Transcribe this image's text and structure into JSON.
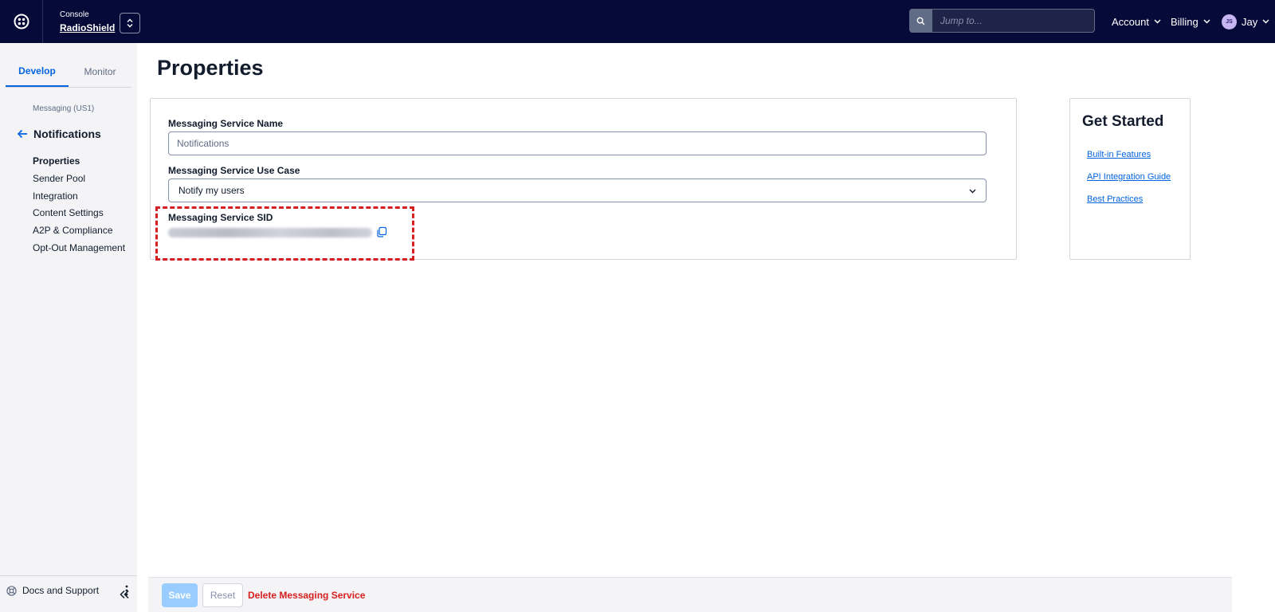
{
  "topbar": {
    "console_label": "Console",
    "account_name": "RadioShield",
    "search_placeholder": "Jump to...",
    "account_menu": "Account",
    "billing_menu": "Billing",
    "user_initials": "JS",
    "user_name": "Jay"
  },
  "sidebar": {
    "tabs": [
      {
        "label": "Develop",
        "active": true
      },
      {
        "label": "Monitor",
        "active": false
      }
    ],
    "breadcrumb": "Messaging (US1)",
    "section_title": "Notifications",
    "items": [
      {
        "label": "Properties",
        "active": true
      },
      {
        "label": "Sender Pool"
      },
      {
        "label": "Integration"
      },
      {
        "label": "Content Settings"
      },
      {
        "label": "A2P & Compliance"
      },
      {
        "label": "Opt-Out Management"
      }
    ],
    "docs_label": "Docs and Support"
  },
  "main": {
    "page_title": "Properties",
    "fields": {
      "name_label": "Messaging Service Name",
      "name_placeholder": "Notifications",
      "use_case_label": "Messaging Service Use Case",
      "use_case_value": "Notify my users",
      "sid_label": "Messaging Service SID"
    }
  },
  "get_started": {
    "title": "Get Started",
    "links": [
      "Built-in Features",
      "API Integration Guide",
      "Best Practices"
    ]
  },
  "footer": {
    "save_label": "Save",
    "reset_label": "Reset",
    "delete_label": "Delete Messaging Service"
  },
  "colors": {
    "topbar_bg": "#060a38",
    "accent_blue": "#0263e0",
    "danger_red": "#d61f1f",
    "save_disabled": "#99cdff"
  }
}
